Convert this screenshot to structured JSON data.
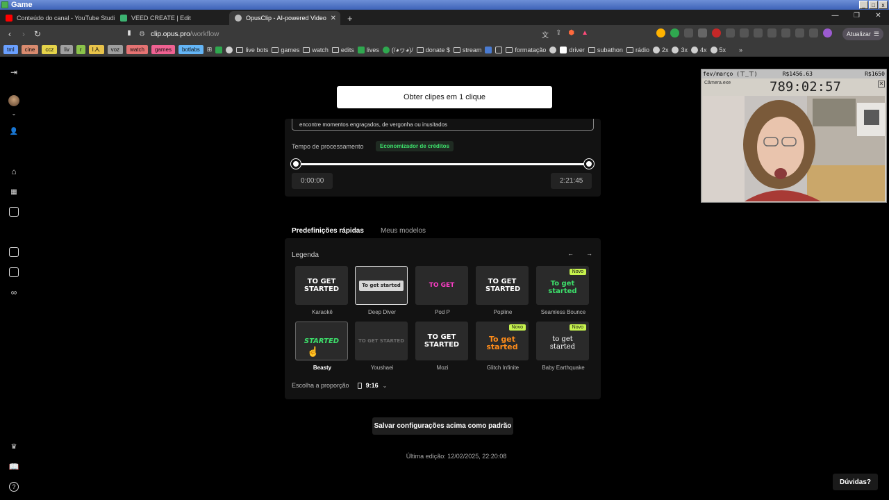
{
  "window": {
    "app_name": "Game"
  },
  "tabs": [
    {
      "label": "Conteúdo do canal - YouTube Studio",
      "color": "#ff0000"
    },
    {
      "label": "VEED CREATE | Edit",
      "color": "#3cb371"
    },
    {
      "label": "OpusClip - AI-powered Video Re",
      "color": "#bbbbbb"
    }
  ],
  "address": {
    "host": "clip.opus.pro",
    "path": "/workflow",
    "update_label": "Atualizar"
  },
  "bookmarks": {
    "chips": [
      {
        "label": "tml",
        "color": "#6aa0ff"
      },
      {
        "label": "cine",
        "color": "#d98b6f"
      },
      {
        "label": "ccz",
        "color": "#e5d34a"
      },
      {
        "label": "liv",
        "color": "#a0a0a0"
      },
      {
        "label": "r",
        "color": "#8bc34a"
      },
      {
        "label": "I.A.",
        "color": "#e8c34a"
      },
      {
        "label": "voz",
        "color": "#9e9e9e"
      },
      {
        "label": "watch",
        "color": "#e57373"
      },
      {
        "label": "games",
        "color": "#f06292"
      },
      {
        "label": "botlabs",
        "color": "#64b5f6"
      }
    ],
    "items": [
      "live bots",
      "games",
      "watch",
      "edits",
      "lives",
      "(/◕ヮ◕)/",
      "donate $",
      "stream",
      "formatação",
      "driver",
      "subathon",
      "rádio",
      "2x",
      "3x",
      "4x",
      "5x"
    ]
  },
  "main": {
    "cta_label": "Obter clipes em 1 clique",
    "prompt_text": "encontre momentos engraçados, de vergonha ou inusitados",
    "processing_label": "Tempo de processamento",
    "credits_badge": "Economizador de créditos",
    "time_start": "0:00:00",
    "time_end": "2:21:45",
    "tabs": [
      "Predefinições rápidas",
      "Meus modelos"
    ],
    "caption_label": "Legenda",
    "ratio_label": "Escolha a proporção",
    "ratio_value": "9:16",
    "save_label": "Salvar configurações acima como padrão",
    "last_edit": "Última edição: 12/02/2025, 22:20:08",
    "help_label": "Dúvidas?"
  },
  "styles": [
    {
      "name": "Karaokê",
      "text": "TO GET STARTED",
      "color": "#ffffff",
      "new": false
    },
    {
      "name": "Deep Diver",
      "text": "To get started",
      "color": "#222222",
      "new": false
    },
    {
      "name": "Pod P",
      "text": "TO GET",
      "color": "#ff3ec8",
      "new": false
    },
    {
      "name": "Popline",
      "text": "TO GET STARTED",
      "color": "#ffffff",
      "new": false
    },
    {
      "name": "Seamless Bounce",
      "text": "To get started",
      "color": "#3de06b",
      "new": true
    },
    {
      "name": "Beasty",
      "text": "STARTED",
      "color": "#3de06b",
      "new": false
    },
    {
      "name": "Youshaei",
      "text": "TO GET STARTED",
      "color": "#6b6b6b",
      "new": false
    },
    {
      "name": "Mozi",
      "text": "TO GET STARTED",
      "color": "#ffffff",
      "new": false
    },
    {
      "name": "Glitch Infinite",
      "text": "To get started",
      "color": "#ff8c1a",
      "new": true
    },
    {
      "name": "Baby Earthquake",
      "text": "to get started",
      "color": "#ffffff",
      "new": true
    }
  ],
  "new_badge": "Novo",
  "overlay": {
    "month": "fev/março (ㄒ_ㄒ)",
    "goal_a": "R$1456.63",
    "goal_b": "R$1650",
    "caption": "Câmera.exe",
    "timer": "789:02:57"
  }
}
